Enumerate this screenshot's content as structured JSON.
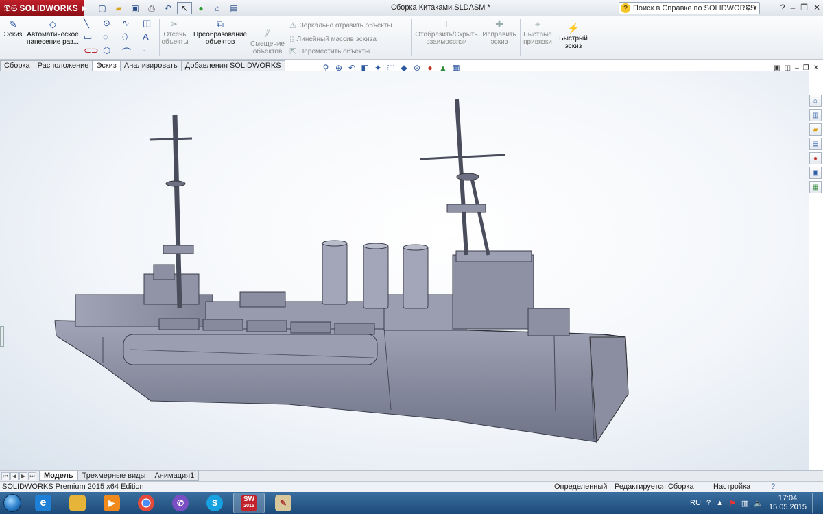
{
  "app": {
    "brand": "SOLIDWORKS",
    "document_title": "Сборка Китаками.SLDASM *",
    "help_search_placeholder": "Поиск в Справке по SOLIDWORKS"
  },
  "ribbon": {
    "sketch": "Эскиз",
    "smart_dimension": "Автоматическое нанесение раз...",
    "trim": "Отсечь объекты",
    "convert": "Преобразование объектов",
    "offset": "Смещение объектов",
    "mirror": "Зеркально отразить объекты",
    "linear_pattern": "Линейный массив эскиза",
    "move": "Переместить объекты",
    "show_hide_relations": "Отобразить/Скрыть взаимосвязи",
    "repair_sketch": "Исправить эскиз",
    "quick_snaps": "Быстрые привязки",
    "rapid_sketch": "Быстрый эскиз"
  },
  "command_tabs": [
    {
      "label": "Сборка"
    },
    {
      "label": "Расположение"
    },
    {
      "label": "Эскиз"
    },
    {
      "label": "Анализировать"
    },
    {
      "label": "Добавления SOLIDWORKS"
    }
  ],
  "bottom_tabs": [
    {
      "label": "Модель"
    },
    {
      "label": "Трехмерные виды"
    },
    {
      "label": "Анимация1"
    }
  ],
  "status": {
    "edition": "SOLIDWORKS Premium 2015 x64 Edition",
    "defined": "Определенный",
    "editing": "Редактируется Сборка",
    "settings": "Настройка"
  },
  "taskbar": {
    "language": "RU",
    "time": "17:04",
    "date": "15.05.2015",
    "sw_badge": "2015"
  },
  "colors": {
    "brand_red": "#b8232c",
    "ship_gray": "#8e92a4",
    "taskbar_blue": "#2a5a8c"
  }
}
